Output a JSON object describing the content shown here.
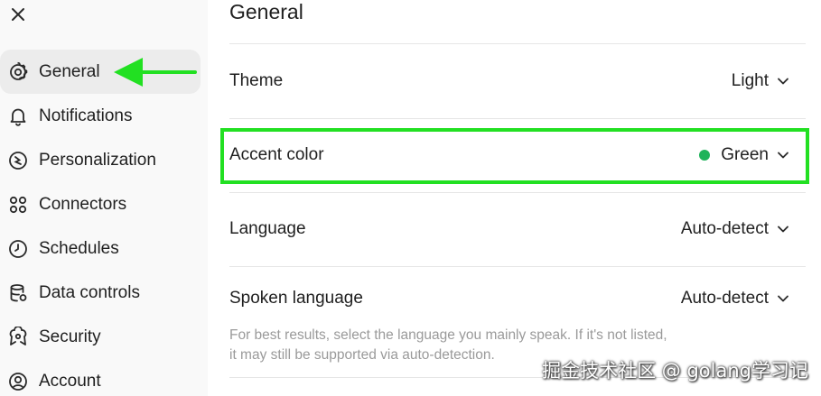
{
  "sidebar": {
    "items": [
      {
        "label": "General",
        "icon": "gear-icon",
        "active": true
      },
      {
        "label": "Notifications",
        "icon": "bell-icon",
        "active": false
      },
      {
        "label": "Personalization",
        "icon": "personalization-icon",
        "active": false
      },
      {
        "label": "Connectors",
        "icon": "connectors-icon",
        "active": false
      },
      {
        "label": "Schedules",
        "icon": "clock-icon",
        "active": false
      },
      {
        "label": "Data controls",
        "icon": "database-icon",
        "active": false
      },
      {
        "label": "Security",
        "icon": "shield-icon",
        "active": false
      },
      {
        "label": "Account",
        "icon": "account-icon",
        "active": false
      }
    ]
  },
  "main": {
    "title": "General",
    "settings": {
      "theme": {
        "label": "Theme",
        "value": "Light"
      },
      "accent_color": {
        "label": "Accent color",
        "value": "Green",
        "dot_color": "#1fb35a"
      },
      "language": {
        "label": "Language",
        "value": "Auto-detect"
      },
      "spoken_language": {
        "label": "Spoken language",
        "value": "Auto-detect",
        "help_line1": "For best results, select the language you mainly speak. If it's not listed,",
        "help_line2": "it may still be supported via auto-detection."
      }
    }
  },
  "annotations": {
    "highlight_color": "#22e022"
  },
  "watermark": "掘金技术社区 @ golang学习记"
}
